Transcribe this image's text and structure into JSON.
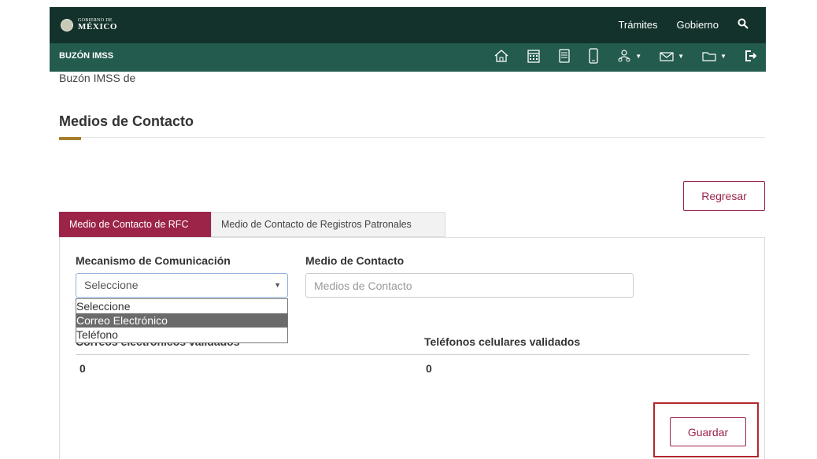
{
  "header": {
    "logo_small": "GOBIERNO DE",
    "logo_big": "MÉXICO",
    "nav": [
      "Trámites",
      "Gobierno"
    ],
    "search_icon": "search-icon"
  },
  "subbar": {
    "brand": "BUZÓN IMSS",
    "icons": [
      "home-icon",
      "calendar-icon",
      "document-icon",
      "mobile-icon",
      "users-icon",
      "mail-icon",
      "folder-icon",
      "logout-icon"
    ]
  },
  "breadcrumb": "Buzón IMSS de",
  "page_title": "Medios de Contacto",
  "back_button": "Regresar",
  "tabs": [
    {
      "label": "Medio de Contacto de RFC",
      "active": true
    },
    {
      "label": "Medio de Contacto de Registros Patronales",
      "active": false
    }
  ],
  "form": {
    "mechanism_label": "Mecanismo de Comunicación",
    "mechanism_value": "Seleccione",
    "mechanism_options": [
      "Seleccione",
      "Correo Electrónico",
      "Teléfono"
    ],
    "highlighted_option": 1,
    "contact_label": "Medio de Contacto",
    "contact_placeholder": "Medios de Contacto"
  },
  "stats": {
    "emails_label": "Correos electrónicos validados",
    "emails_value": "0",
    "phones_label": "Teléfonos celulares validados",
    "phones_value": "0"
  },
  "save_button": "Guardar",
  "colors": {
    "header_dark": "#13322b",
    "header_green": "#235b4e",
    "accent": "#9d2449",
    "gold": "#a57f2c"
  }
}
